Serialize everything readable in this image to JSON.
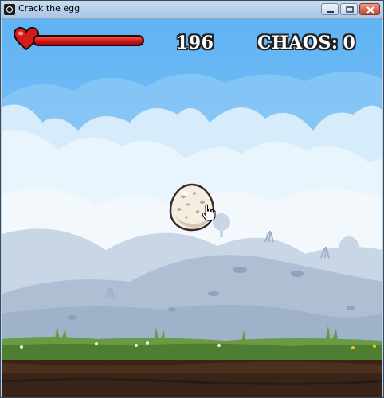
{
  "window": {
    "title": "Crack the egg",
    "buttons": [
      "minimize",
      "maximize",
      "close"
    ]
  },
  "hud": {
    "health_icon": "heart-icon",
    "health_fraction": 1.0,
    "score": "196",
    "chaos_label": "CHAOS:",
    "chaos_value": "0"
  },
  "scene": {
    "egg_icon": "egg-icon",
    "cursor_icon": "hand-pointer-icon",
    "colors": {
      "sky": "#6cbcf6",
      "cloud": "#cfe8fb",
      "hill": "#bccbdc",
      "grass": "#5d8a3c",
      "soil": "#3a2418",
      "health": "#d11717"
    }
  }
}
